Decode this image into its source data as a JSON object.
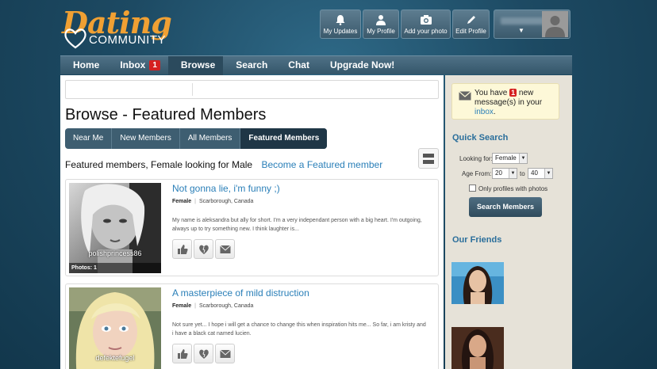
{
  "brand": {
    "name": "Dating",
    "sub": "COMMUNITY",
    "orange": "#f0a033"
  },
  "header": {
    "buttons": [
      {
        "label": "My Updates",
        "icon": "bell-icon"
      },
      {
        "label": "My Profile",
        "icon": "person-icon"
      },
      {
        "label": "Add your photo",
        "icon": "camera-icon"
      },
      {
        "label": "Edit Profile",
        "icon": "pencil-icon"
      }
    ],
    "user_caret": "▼"
  },
  "nav": {
    "items": [
      "Home",
      "Inbox",
      "Browse",
      "Search",
      "Chat",
      "Upgrade Now!"
    ],
    "inbox_count": "1",
    "active": "Browse"
  },
  "main": {
    "title": "Browse - Featured Members",
    "tabs": [
      "Near Me",
      "New Members",
      "All Members",
      "Featured Members"
    ],
    "active_tab": "Featured Members",
    "subtitle": "Featured members, Female looking for Male",
    "become_link": "Become a Featured member",
    "members": [
      {
        "title": "Not gonna lie, i'm funny ;)",
        "gender": "Female",
        "location": "Scarborough, Canada",
        "desc": "My name is aleksandra but ally for short. I'm a very independant person with a big heart. I'm outgoing, always up to try something new. I think laughter is...",
        "username": "polishprincess86",
        "photos": "Photos: 1"
      },
      {
        "title": "A masterpiece of mild distruction",
        "gender": "Female",
        "location": "Scarborough, Canada",
        "desc": "Not sure yet... I hope i will get a chance to change this when inspiration hits me... So far, i am kristy and i have a black cat named lucien.",
        "username": "defektefugel",
        "photos": ""
      }
    ]
  },
  "sidebar": {
    "notif": {
      "pre": "You have",
      "count": "1",
      "post": "new message(s) in your",
      "link": "inbox",
      "end": "."
    },
    "quick_search": {
      "title": "Quick Search",
      "looking_for_label": "Looking for:",
      "looking_for_value": "Female",
      "age_label": "Age From:",
      "age_from": "20",
      "age_to_label": "to",
      "age_to": "40",
      "only_photos_label": "Only profiles with photos",
      "button": "Search Members"
    },
    "friends_title": "Our Friends"
  },
  "colors": {
    "link": "#2a7fb8",
    "accent_red": "#d52020",
    "nav": "#3e5e71"
  }
}
